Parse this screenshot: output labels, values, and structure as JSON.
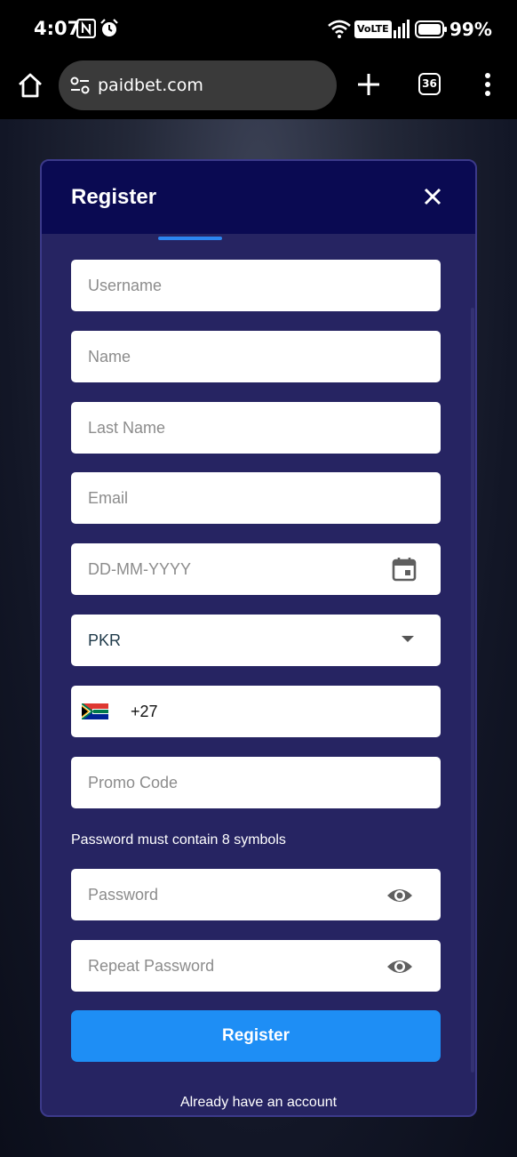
{
  "status_bar": {
    "time": "4:07",
    "volte": "VoLTE",
    "battery": "99%"
  },
  "browser": {
    "url": "paidbet.com",
    "tab_count": "36"
  },
  "modal": {
    "title": "Register",
    "fields": {
      "username": "Username",
      "name": "Name",
      "last_name": "Last Name",
      "email": "Email",
      "birthdate": "DD-MM-YYYY",
      "currency": "PKR",
      "phone_code": "+27",
      "promo_code": "Promo Code",
      "password": "Password",
      "repeat_password": "Repeat Password"
    },
    "password_hint": "Password must contain 8 symbols",
    "register_label": "Register",
    "login_link": "Already have an account"
  },
  "colors": {
    "modal_bg": "#262462",
    "header_bg": "#0a0a52",
    "accent": "#1e8ef5"
  }
}
